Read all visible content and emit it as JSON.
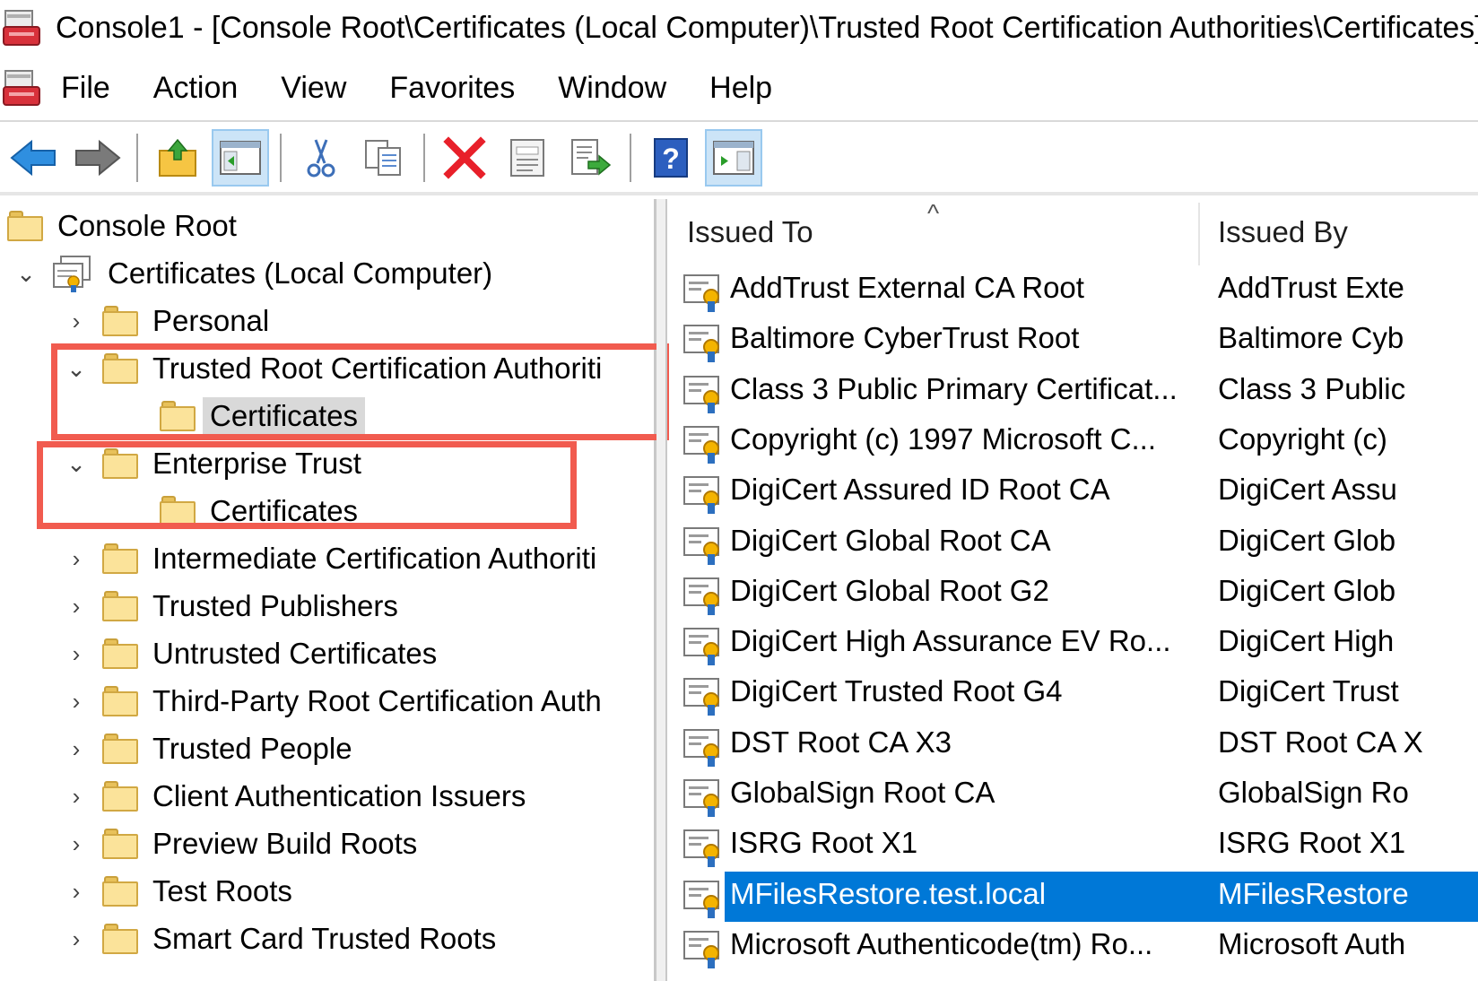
{
  "window": {
    "title": "Console1 - [Console Root\\Certificates (Local Computer)\\Trusted Root Certification Authorities\\Certificates]"
  },
  "menu": {
    "items": [
      "File",
      "Action",
      "View",
      "Favorites",
      "Window",
      "Help"
    ]
  },
  "toolbar": {
    "buttons": [
      "back-icon",
      "forward-icon",
      "up-folder-icon",
      "show-hide-tree-icon",
      "cut-icon",
      "copy-icon",
      "delete-icon",
      "properties-icon",
      "export-list-icon",
      "help-icon",
      "show-hide-action-pane-icon"
    ],
    "active": [
      "show-hide-tree-icon",
      "show-hide-action-pane-icon"
    ]
  },
  "tree": {
    "root": "Console Root",
    "computer": "Certificates (Local Computer)",
    "nodes": [
      {
        "label": "Personal",
        "expanded": false
      },
      {
        "label": "Trusted Root Certification Authoriti",
        "expanded": true,
        "child": "Certificates",
        "child_selected": true
      },
      {
        "label": "Enterprise Trust",
        "expanded": true,
        "child": "Certificates"
      },
      {
        "label": "Intermediate Certification Authoriti",
        "expanded": false
      },
      {
        "label": "Trusted Publishers",
        "expanded": false
      },
      {
        "label": "Untrusted Certificates",
        "expanded": false
      },
      {
        "label": "Third-Party Root Certification Auth",
        "expanded": false
      },
      {
        "label": "Trusted People",
        "expanded": false
      },
      {
        "label": "Client Authentication Issuers",
        "expanded": false
      },
      {
        "label": "Preview Build Roots",
        "expanded": false
      },
      {
        "label": "Test Roots",
        "expanded": false
      },
      {
        "label": "Smart Card Trusted Roots",
        "expanded": false
      }
    ]
  },
  "list": {
    "columns": {
      "issued_to": "Issued To",
      "issued_by": "Issued By"
    },
    "sort_indicator": "^",
    "rows": [
      {
        "issued_to": "AddTrust External CA Root",
        "issued_by": "AddTrust Exte"
      },
      {
        "issued_to": "Baltimore CyberTrust Root",
        "issued_by": "Baltimore Cyb"
      },
      {
        "issued_to": "Class 3 Public Primary Certificat...",
        "issued_by": "Class 3 Public"
      },
      {
        "issued_to": "Copyright (c) 1997 Microsoft C...",
        "issued_by": "Copyright (c)"
      },
      {
        "issued_to": "DigiCert Assured ID Root CA",
        "issued_by": "DigiCert Assu"
      },
      {
        "issued_to": "DigiCert Global Root CA",
        "issued_by": "DigiCert Glob"
      },
      {
        "issued_to": "DigiCert Global Root G2",
        "issued_by": "DigiCert Glob"
      },
      {
        "issued_to": "DigiCert High Assurance EV Ro...",
        "issued_by": "DigiCert High"
      },
      {
        "issued_to": "DigiCert Trusted Root G4",
        "issued_by": "DigiCert Trust"
      },
      {
        "issued_to": "DST Root CA X3",
        "issued_by": "DST Root CA X"
      },
      {
        "issued_to": "GlobalSign Root CA",
        "issued_by": "GlobalSign Ro"
      },
      {
        "issued_to": "ISRG Root X1",
        "issued_by": "ISRG Root X1"
      },
      {
        "issued_to": "MFilesRestore.test.local",
        "issued_by": "MFilesRestore",
        "selected": true
      },
      {
        "issued_to": "Microsoft Authenticode(tm) Ro...",
        "issued_by": "Microsoft Auth"
      }
    ]
  },
  "colors": {
    "highlight_box": "#f15b4f",
    "selection": "#0078d7"
  }
}
